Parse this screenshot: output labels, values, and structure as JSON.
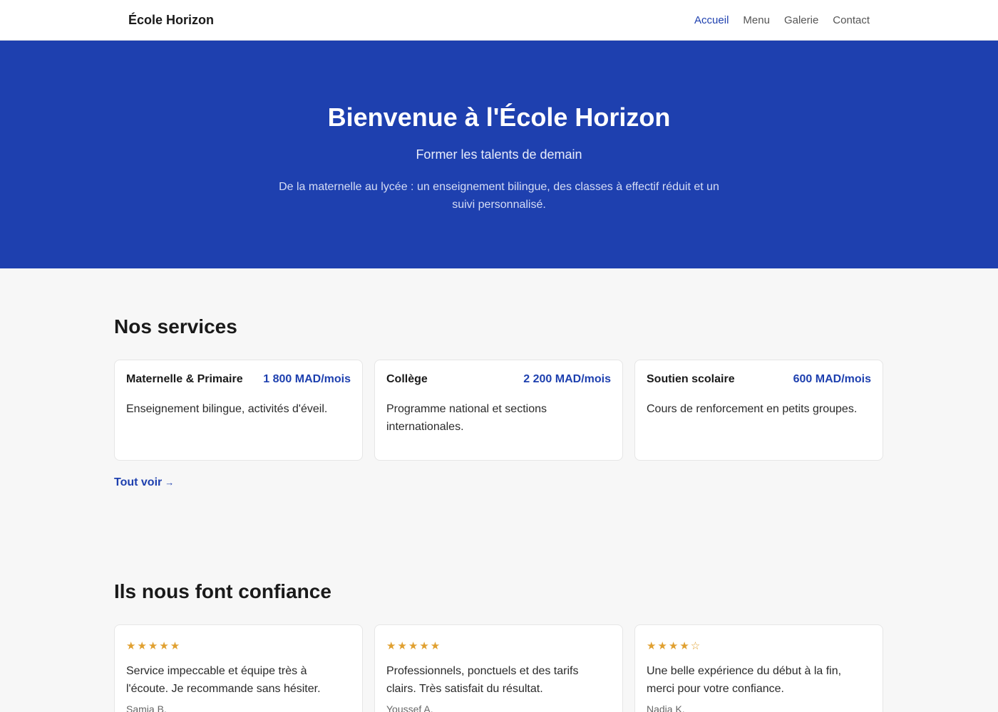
{
  "nav": {
    "brand": "École Horizon",
    "links": [
      {
        "label": "Accueil",
        "active": true
      },
      {
        "label": "Menu",
        "active": false
      },
      {
        "label": "Galerie",
        "active": false
      },
      {
        "label": "Contact",
        "active": false
      }
    ]
  },
  "hero": {
    "title": "Bienvenue à l'École Horizon",
    "subtitle": "Former les talents de demain",
    "description": "De la maternelle au lycée : un enseignement bilingue, des classes à effectif réduit et un suivi personnalisé."
  },
  "services": {
    "title": "Nos services",
    "items": [
      {
        "name": "Maternelle & Primaire",
        "price": "1 800 MAD/mois",
        "description": "Enseignement bilingue, activités d'éveil."
      },
      {
        "name": "Collège",
        "price": "2 200 MAD/mois",
        "description": "Programme national et sections internationales."
      },
      {
        "name": "Soutien scolaire",
        "price": "600 MAD/mois",
        "description": "Cours de renforcement en petits groupes."
      }
    ],
    "see_all": "Tout voir",
    "see_all_arrow": "→"
  },
  "testimonials": {
    "title": "Ils nous font confiance",
    "items": [
      {
        "stars": "★★★★★",
        "rating": 5,
        "quote": "Service impeccable et équipe très à l'écoute. Je recommande sans hésiter.",
        "author": "Samia B."
      },
      {
        "stars": "★★★★★",
        "rating": 5,
        "quote": "Professionnels, ponctuels et des tarifs clairs. Très satisfait du résultat.",
        "author": "Youssef A."
      },
      {
        "stars": "★★★★☆",
        "rating": 4,
        "quote": "Une belle expérience du début à la fin, merci pour votre confiance.",
        "author": "Nadia K."
      }
    ]
  },
  "colors": {
    "accent": "#1e40af",
    "star": "#e0a030",
    "background": "#f7f7f7"
  }
}
